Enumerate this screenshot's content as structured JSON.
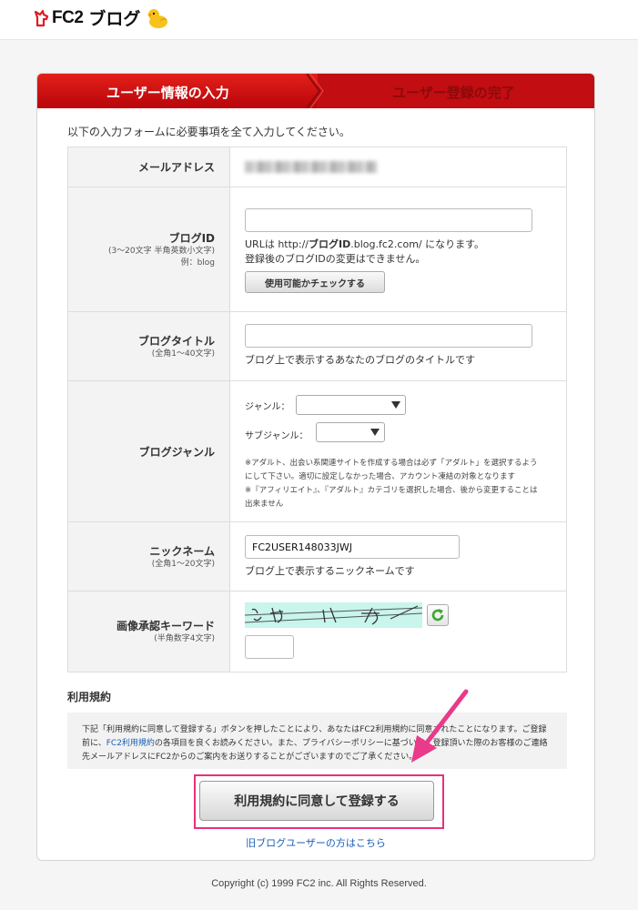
{
  "header": {
    "logo_text": "FC2",
    "service_name": "ブログ"
  },
  "steps": [
    {
      "label": "ユーザー情報の入力",
      "state": "active"
    },
    {
      "label": "ユーザー登録の完了",
      "state": "inactive"
    }
  ],
  "intro": "以下の入力フォームに必要事項を全て入力してください。",
  "fields": {
    "email": {
      "label": "メールアドレス"
    },
    "blog_id": {
      "label": "ブログID",
      "sub1": "(3〜20文字 半角英数小文字)",
      "sub2": "例：blog",
      "value": "",
      "help_prefix": "URLは http://",
      "help_bold": "ブログID",
      "help_suffix": ".blog.fc2.com/ になります。",
      "help2": "登録後のブログIDの変更はできません。",
      "check_button": "使用可能かチェックする"
    },
    "blog_title": {
      "label": "ブログタイトル",
      "sub": "(全角1〜40文字)",
      "value": "",
      "help": "ブログ上で表示するあなたのブログのタイトルです"
    },
    "genre": {
      "label": "ブログジャンル",
      "genre_label": "ジャンル：",
      "genre_value": "",
      "subgenre_label": "サブジャンル：",
      "subgenre_value": "",
      "note1": "※アダルト、出会い系関連サイトを作成する場合は必ず「アダルト」を選択するようにして下さい。適切に設定しなかった場合、アカウント凍結の対象となります",
      "note2": "※『アフィリエイト』、『アダルト』カテゴリを選択した場合、後から変更することは出来ません"
    },
    "nickname": {
      "label": "ニックネーム",
      "sub": "(全角1〜20文字)",
      "value": "FC2USER148033JWJ",
      "help": "ブログ上で表示するニックネームです"
    },
    "captcha": {
      "label": "画像承認キーワード",
      "sub": "(半角数字4文字)",
      "value": ""
    }
  },
  "terms": {
    "title": "利用規約",
    "text1": "下記「利用規約に同意して登録する」ボタンを押したことにより、あなたはFC2利用規約に同意されたことになります。ご登録前に、",
    "link": "FC2利用規約",
    "text2": "の各項目を良くお読みください。また、プライバシーポリシーに基づいてご登録頂いた際のお客様のご連絡先メールアドレスにFC2からのご案内をお送りすることがございますのでご了承ください。"
  },
  "agree_button": "利用規約に同意して登録する",
  "old_user_link": "旧ブログユーザーの方はこちら",
  "copyright": "Copyright (c) 1999 FC2 inc. All Rights Reserved.",
  "colors": {
    "header_red": "#d4141b",
    "highlight_pink": "#e8317a",
    "captcha_bg": "#c8f5ec",
    "link_blue": "#1a5fb4"
  },
  "icons": {
    "logo_mark": "fc2-unicorn-icon",
    "mascot": "duck-mascot-icon",
    "refresh": "refresh-icon",
    "dropdown": "chevron-down-icon",
    "annotation": "arrow-pointer-icon"
  }
}
